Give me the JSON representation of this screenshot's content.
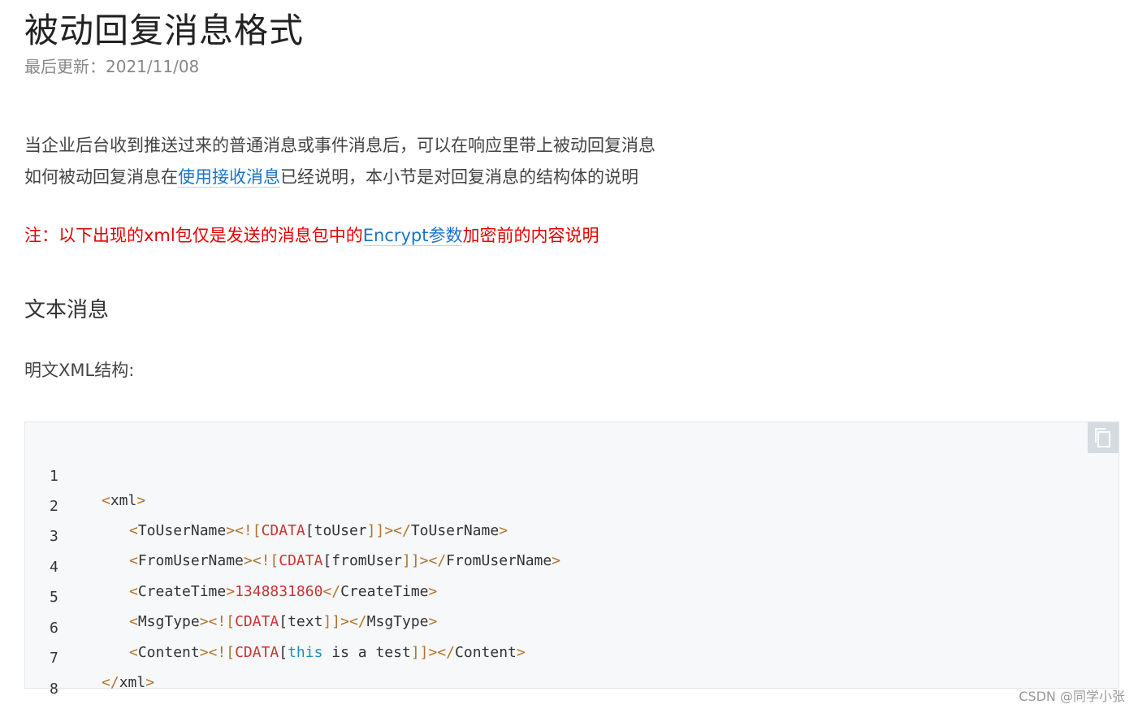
{
  "page": {
    "title": "被动回复消息格式",
    "updated": "最后更新：2021/11/08"
  },
  "intro": {
    "line1": "当企业后台收到推送过来的普通消息或事件消息后，可以在响应里带上被动回复消息",
    "line2_prefix": "如何被动回复消息在",
    "line2_link": "使用接收消息",
    "line2_suffix": "已经说明，本小节是对回复消息的结构体的说明"
  },
  "note": {
    "prefix": "注：以下出现的xml包仅是发送的消息包中的",
    "link": "Encrypt参数",
    "suffix": "加密前的内容说明"
  },
  "section": {
    "heading": "文本消息",
    "plain_label": "明文XML结构:"
  },
  "code": {
    "line_numbers": [
      "1",
      "2",
      "3",
      "4",
      "5",
      "6",
      "7",
      "8"
    ],
    "l1": {
      "open": "<",
      "tag": "xml",
      "close": ">"
    },
    "l2": {
      "a": "<",
      "tag": "ToUserName",
      "b": "><![",
      "cdata": "CDATA",
      "c": "[",
      "val": "toUser",
      "d": "]]></",
      "etag": "ToUserName",
      "e": ">"
    },
    "l3": {
      "a": "<",
      "tag": "FromUserName",
      "b": "><![",
      "cdata": "CDATA",
      "c": "[",
      "val": "fromUser",
      "d": "]]></",
      "etag": "FromUserName",
      "e": ">"
    },
    "l4": {
      "a": "<",
      "tag": "CreateTime",
      "b": ">",
      "val": "1348831860",
      "d": "</",
      "etag": "CreateTime",
      "e": ">"
    },
    "l5": {
      "a": "<",
      "tag": "MsgType",
      "b": "><![",
      "cdata": "CDATA",
      "c": "[",
      "val": "text",
      "d": "]]></",
      "etag": "MsgType",
      "e": ">"
    },
    "l6": {
      "a": "<",
      "tag": "Content",
      "b": "><![",
      "cdata": "CDATA",
      "c": "[",
      "kw": "this",
      "val": " is a test",
      "d": "]]></",
      "etag": "Content",
      "e": ">"
    },
    "l7": {
      "open": "</",
      "tag": "xml",
      "close": ">"
    }
  },
  "copy_icon": "copy-icon",
  "watermark": "CSDN @同学小张"
}
